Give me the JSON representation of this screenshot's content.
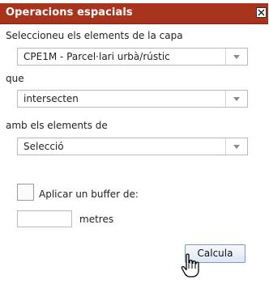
{
  "panel": {
    "title": "Operacions espacials",
    "close_icon": "close-icon"
  },
  "form": {
    "select_layer_label": "Seleccioneu els elements de la capa",
    "layer_value": "CPE1M - Parcel·lari urbà/rústic",
    "relation_label": "que",
    "relation_value": "intersecten",
    "target_label": "amb els elements de",
    "target_value": "Selecció",
    "buffer_checkbox_label": "Aplicar un buffer de:",
    "buffer_checked": false,
    "buffer_value": "",
    "buffer_unit": "metres",
    "submit_label": "Calcula"
  },
  "colors": {
    "titlebar": "#a8341e",
    "button_border": "#7a9ac0"
  }
}
